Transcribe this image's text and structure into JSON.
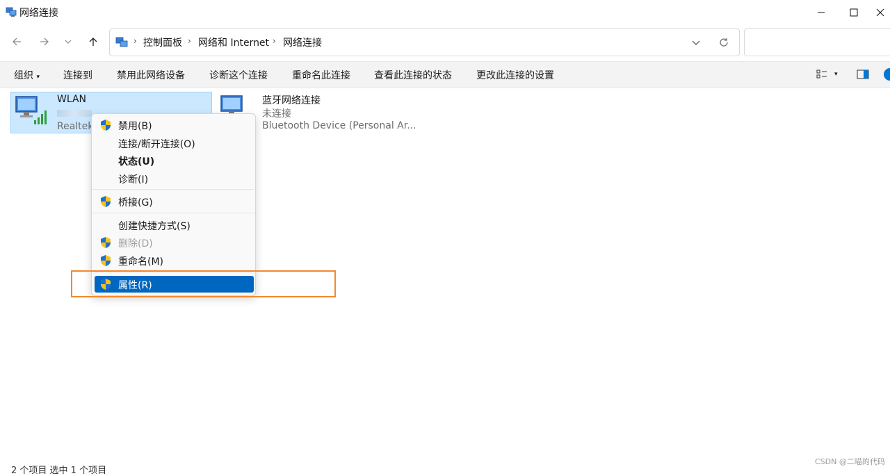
{
  "window": {
    "title": "网络连接",
    "minimize_icon": "minimize-icon",
    "maximize_icon": "maximize-icon",
    "close_icon": "close-icon"
  },
  "nav": {
    "back_icon": "arrow-left-icon",
    "forward_icon": "arrow-right-icon",
    "recent_icon": "chevron-down-icon",
    "up_icon": "arrow-up-icon"
  },
  "address": {
    "breadcrumbs": [
      "控制面板",
      "网络和 Internet",
      "网络连接"
    ],
    "separator": "›",
    "search_placeholder": ""
  },
  "command_bar": {
    "organize": "组织",
    "connect_to": "连接到",
    "disable_device": "禁用此网络设备",
    "diagnose": "诊断这个连接",
    "rename": "重命名此连接",
    "view_status": "查看此连接的状态",
    "change_settings": "更改此连接的设置"
  },
  "items": [
    {
      "name": "WLAN",
      "status": "",
      "device": "Realtek"
    },
    {
      "name": "蓝牙网络连接",
      "status": "未连接",
      "device": "Bluetooth Device (Personal Ar..."
    }
  ],
  "context_menu": {
    "items": [
      {
        "label": "禁用(B)",
        "shield": true,
        "bold": false,
        "disabled": false,
        "selected": false
      },
      {
        "label": "连接/断开连接(O)",
        "shield": false,
        "bold": false,
        "disabled": false,
        "selected": false
      },
      {
        "label": "状态(U)",
        "shield": false,
        "bold": true,
        "disabled": false,
        "selected": false
      },
      {
        "label": "诊断(I)",
        "shield": false,
        "bold": false,
        "disabled": false,
        "selected": false
      },
      {
        "label": "桥接(G)",
        "shield": true,
        "bold": false,
        "disabled": false,
        "selected": false
      },
      {
        "label": "创建快捷方式(S)",
        "shield": false,
        "bold": false,
        "disabled": false,
        "selected": false
      },
      {
        "label": "删除(D)",
        "shield": true,
        "bold": false,
        "disabled": true,
        "selected": false
      },
      {
        "label": "重命名(M)",
        "shield": true,
        "bold": false,
        "disabled": false,
        "selected": false
      },
      {
        "label": "属性(R)",
        "shield": true,
        "bold": false,
        "disabled": false,
        "selected": true
      }
    ]
  },
  "status_bar": {
    "text": "2 个项目    选中 1 个项目"
  },
  "watermark": "CSDN @二喵的代码",
  "colors": {
    "selection": "#cce8ff",
    "menu_selected": "#0067c0",
    "highlight_box": "#f28a2e",
    "command_bar_bg": "#f3f3f3"
  }
}
